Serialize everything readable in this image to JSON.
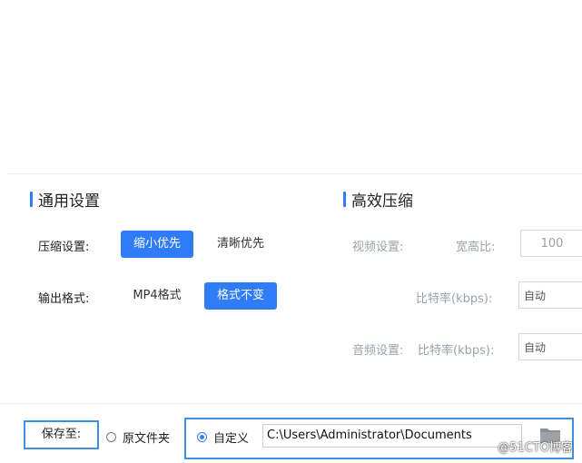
{
  "general": {
    "title": "通用设置",
    "compress_label": "压缩设置:",
    "compress_options": [
      "缩小优先",
      "清晰优先"
    ],
    "output_label": "输出格式:",
    "output_options": [
      "MP4格式",
      "格式不变"
    ]
  },
  "efficient": {
    "title": "高效压缩",
    "video_label": "视频设置:",
    "aspect_label": "宽高比:",
    "aspect_value": "100",
    "bitrate_label": "比特率(kbps):",
    "bitrate_value": "自动",
    "audio_label": "音频设置:",
    "audio_bitrate_label": "比特率(kbps):",
    "audio_bitrate_value": "自动"
  },
  "save": {
    "label": "保存至:",
    "original_folder": "原文件夹",
    "custom": "自定义",
    "path": "C:\\Users\\Administrator\\Documents"
  },
  "watermark": "@51CTO博客",
  "colors": {
    "accent": "#2f7cf6",
    "highlight_border": "#3d8fe0"
  }
}
